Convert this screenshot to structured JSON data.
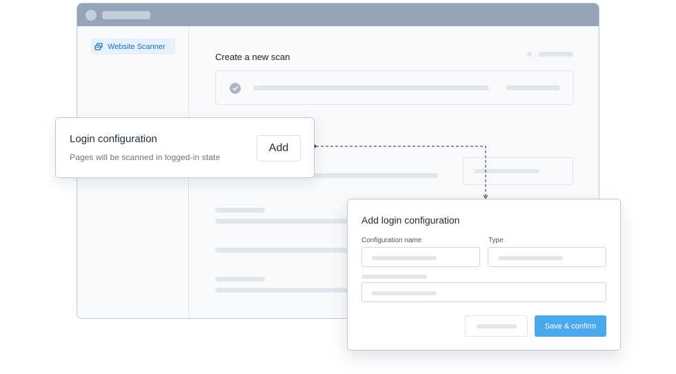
{
  "sidebar": {
    "items": [
      {
        "label": "Website Scanner",
        "icon": "scanner-icon",
        "active": true
      }
    ]
  },
  "main": {
    "title": "Create a new scan"
  },
  "login_card": {
    "title": "Login configuration",
    "subtitle": "Pages will be scanned in logged-in state",
    "add_label": "Add"
  },
  "modal": {
    "title": "Add login configuration",
    "fields": {
      "config_name_label": "Configuration name",
      "type_label": "Type"
    },
    "save_label": "Save & confirm"
  },
  "colors": {
    "accent": "#4aa8ee",
    "sidebar_active_text": "#1a6fc0",
    "titlebar": "#95a4b6"
  }
}
